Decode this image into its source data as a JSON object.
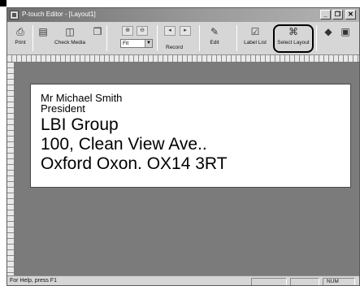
{
  "window": {
    "title": "P-touch Editor - [Layout1]"
  },
  "title_buttons": [
    {
      "icon": "minimize-icon",
      "glyph": "_"
    },
    {
      "icon": "restore-icon",
      "glyph": "❐"
    },
    {
      "icon": "close-icon",
      "glyph": "✕"
    }
  ],
  "toolbar": {
    "print_label": "Print",
    "check_media_label": "Check Media",
    "zoom_value": "Fit",
    "record_label": "Record",
    "edit_label": "Edit",
    "label_list_label": "Label List",
    "select_layout_label": "Select Layout",
    "icons": {
      "print": "printer-icon",
      "check_media": "check-media-icon",
      "edit": "edit-icon",
      "label_list": "label-list-icon",
      "select_layout": "select-layout-icon"
    }
  },
  "label": {
    "lines": [
      "Mr Michael Smith",
      "President",
      "LBI Group",
      "100, Clean View Ave..",
      "Oxford Oxon. OX14 3RT"
    ]
  },
  "status": {
    "help_text": "For Help, press F1",
    "num_indicator": "NUM"
  }
}
